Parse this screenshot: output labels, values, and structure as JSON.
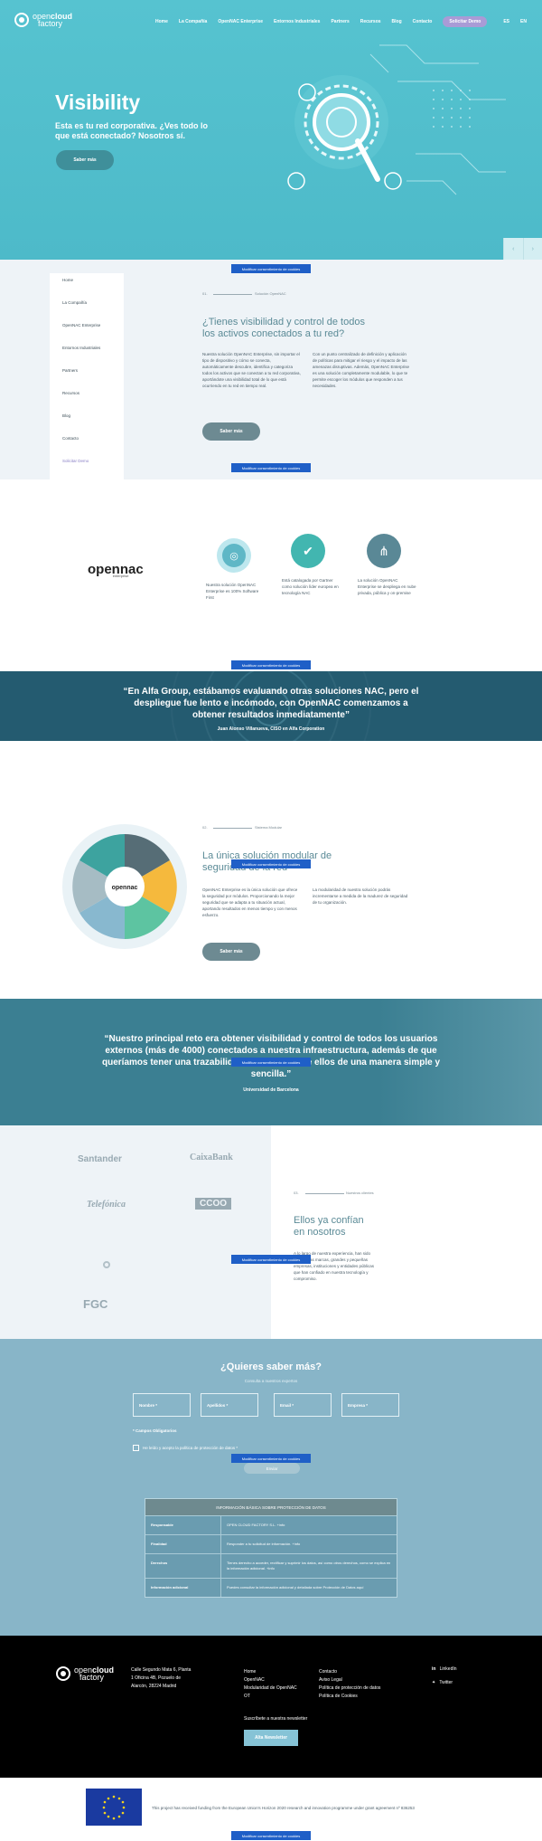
{
  "nav": {
    "logo_text_1": "open",
    "logo_text_2": "cloud",
    "logo_text_3": "factory",
    "items": [
      "Home",
      "La Compañía",
      "OpenNAC Enterprise",
      "Entornos Industriales",
      "Partners",
      "Recursos",
      "Blog",
      "Contacto"
    ],
    "demo": "Solicitar Demo",
    "lang_es": "ES",
    "lang_en": "EN"
  },
  "hero": {
    "title": "Visibility",
    "subtitle": "Esta es tu red corporativa. ¿Ves todo  lo que está conectado? Nosotros sí.",
    "button": "Saber más",
    "prev": "‹",
    "next": "›"
  },
  "cookie_label": "Modificar consentimiento de cookies",
  "sidebar": [
    "Home",
    "La Compañía",
    "OpenNAC Enterprise",
    "Entornos Industriales",
    "Partners",
    "Recursos",
    "Blog",
    "Contacto",
    "Solicitar Demo"
  ],
  "visibility": {
    "num": "01.",
    "crumb": "Solución OpenNAC",
    "title_1": "¿Tienes visibilidad y control de todos",
    "title_2": "los activos conectados a tu red?",
    "col1": "Nuestra solución OpenNAC Enterprise, sin importar el tipo de dispositivo y cómo se conecta, automáticamente descubre, identifica y categoriza todos los activos que se conectan a tu red corporativa, aportándote una visibilidad total de lo que está ocurriendo en tu red en tiempo real.",
    "col2": "Con un punto centralizado de definición y aplicación de políticas para mitigar el riesgo y el impacto de las amenazas disruptivas. Además, OpenNAC Enterprise es una solución completamente modulable, lo que te permite escoger los módulos que responden a tus necesidades.",
    "button": "Saber más"
  },
  "features": {
    "logo_main": "opennac",
    "logo_sub": "enterprise",
    "items": [
      {
        "text": "Nuestra solución OpenNAC Enterprise es 100% Software First",
        "color": "#5fb7c6"
      },
      {
        "text": "Está catalogada por Gartner como solución líder europea en tecnología NAC",
        "color": "#42b6b0"
      },
      {
        "text": "La solución OpenNAC Enterprise se despliega en nube privada, pública y on-premise",
        "color": "#5a8896"
      }
    ]
  },
  "quote1": {
    "text": "“En Alfa Group, estábamos evaluando otras soluciones NAC, pero el despliegue fue lento e incómodo, con OpenNAC comenzamos a obtener resultados inmediatamente”",
    "author": "Juan Alonso Villanueva, CISO en Alfa Corporation"
  },
  "modular": {
    "num": "02.",
    "crumb": "Sistema Modular",
    "title_1": "La única solución modular de",
    "title_2": "seguridad de la red",
    "col1": "OpenNAC Enterprise es la única solución que ofrece la seguridad por módulos. Proporcionando la mejor seguridad que se adapta a tu situación actual, aportando resultados en menos tiempo y con menos esfuerzo.",
    "col2": "La modularidad de nuestra solución podrás incrementarse a medida de la madurez de seguridad de tu organización.",
    "button": "Saber más",
    "wheel_center": "opennac"
  },
  "quote2": {
    "text": "“Nuestro principal reto era obtener visibilidad y control de todos los usuarios externos (más de 4000) conectados a nuestra infraestructura, además de que queríamos tener una trazabilidad de cada uno de ellos de una manera simple y sencilla.”",
    "author": "Universidad de Barcelona"
  },
  "clients": {
    "logos": [
      "Santander",
      "CaixaBank",
      "Telefónica",
      "CCOO",
      "FGC"
    ],
    "num": "03.",
    "crumb": "Nuestros clientes",
    "title_1": "Ellos ya confían",
    "title_2": "en nosotros",
    "text": "A lo largo de nuestra experiencia, han sido muchas las marcas, grandes y pequeñas empresas, instituciones y entidades públicas que han confiado en nuestra tecnología y compromiso."
  },
  "form": {
    "title": "¿Quieres saber más?",
    "subtitle": "Consulta a nuestros expertos",
    "fields": [
      "Nombre *",
      "Apellidos *",
      "Email *",
      "Empresa *"
    ],
    "required": "* Campos Obligatorios",
    "accept": "He leído y acepto la política de protección de datos *",
    "send": "Enviar",
    "table_title": "INFORMACIÓN BÁSICA SOBRE PROTECCIÓN DE DATOS",
    "rows": [
      {
        "k": "Responsable",
        "v": "OPEN CLOUD FACTORY S.L. +info"
      },
      {
        "k": "Finalidad",
        "v": "Responder a tu solicitud de información. +info"
      },
      {
        "k": "Derechos",
        "v": "Tienes derecho a acceder, rectificar y suprimir los datos, así como otros derechos, como se explica en la información adicional. +info"
      },
      {
        "k": "Información adicional",
        "v": "Puedes consultar la información adicional y detallada sobre Protección de Datos aquí"
      }
    ]
  },
  "footer": {
    "address": [
      "Calle Segundo Mata 6, Planta",
      "1 Oficina 4B, Pozuelo de",
      "Alarcón, 28224 Madrid"
    ],
    "col1": [
      "Home",
      "OpenNAC",
      "Modularidad de OpenNAC",
      "OT"
    ],
    "col2": [
      "Contacto",
      "Aviso Legal",
      "Política de protección de datos",
      "Política de Cookies"
    ],
    "social": [
      "LinkedIn",
      "Twitter"
    ],
    "newsletter_label": "Suscríbete a nuestra newsletter",
    "newsletter_button": "Alta Newsletter",
    "eu_text": "This project has received funding from the European Union's Horizon 2020 research and innovation programme under grant agreement nº 836253"
  }
}
